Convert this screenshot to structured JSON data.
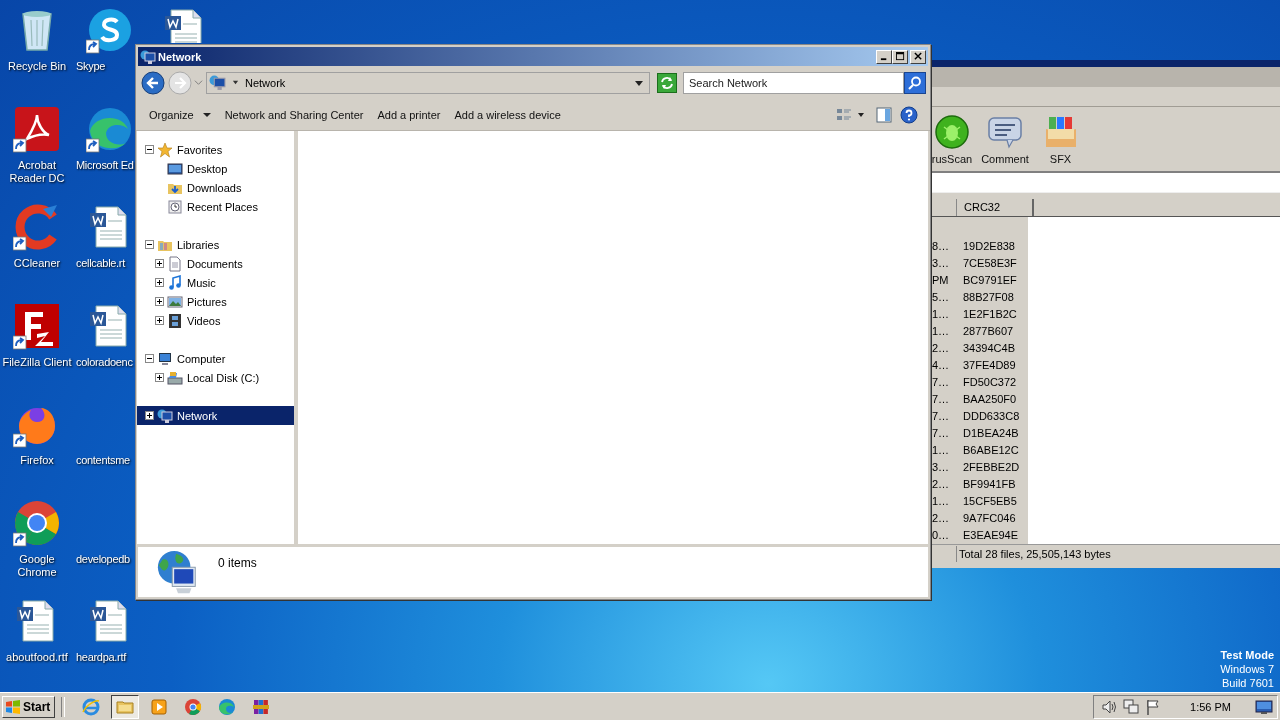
{
  "desktop": {
    "columns": [
      [
        {
          "label": "Recycle Bin",
          "kind": "recycle",
          "shortcut": false
        },
        {
          "label": "Acrobat Reader DC",
          "kind": "acrobat",
          "shortcut": true
        },
        {
          "label": "CCleaner",
          "kind": "ccleaner",
          "shortcut": true
        },
        {
          "label": "FileZilla Client",
          "kind": "filezilla",
          "shortcut": true
        },
        {
          "label": "Firefox",
          "kind": "firefox",
          "shortcut": true
        },
        {
          "label": "Google Chrome",
          "kind": "chrome",
          "shortcut": true
        },
        {
          "label": "aboutfood.rtf",
          "kind": "word",
          "shortcut": false
        }
      ],
      [
        {
          "label": "Skype",
          "kind": "skype",
          "shortcut": true
        },
        {
          "label": "Microsoft Ed",
          "kind": "edge",
          "shortcut": true
        },
        {
          "label": "cellcable.rt",
          "kind": "word",
          "shortcut": false
        },
        {
          "label": "coloradoenc",
          "kind": "word",
          "shortcut": false
        },
        {
          "label": "contentsme",
          "kind": "blank"
        },
        {
          "label": "developedb",
          "kind": "blank"
        },
        {
          "label": "heardpa.rtf",
          "kind": "word",
          "shortcut": false
        }
      ],
      [
        {
          "kind": "word",
          "shortcut": false
        }
      ]
    ],
    "os_notice": [
      "Test Mode",
      "Windows 7",
      "Build 7601"
    ]
  },
  "archiver": {
    "toolbar": [
      {
        "label": "rusScan",
        "kind": "virus"
      },
      {
        "label": "Comment",
        "kind": "comment"
      },
      {
        "label": "SFX",
        "kind": "sfx"
      }
    ],
    "columns": [
      "CRC32"
    ],
    "rows": [
      {
        "column_1": "8…",
        "crc32": "19D2E838"
      },
      {
        "column_1": "3…",
        "crc32": "7CE58E3F"
      },
      {
        "column_1": "PM",
        "crc32": "BC9791EF"
      },
      {
        "column_1": "5…",
        "crc32": "88B27F08"
      },
      {
        "column_1": "1…",
        "crc32": "1E2F1B2C"
      },
      {
        "column_1": "1…",
        "crc32": "2877B607"
      },
      {
        "column_1": "2…",
        "crc32": "34394C4B"
      },
      {
        "column_1": "4…",
        "crc32": "37FE4D89"
      },
      {
        "column_1": "7…",
        "crc32": "FD50C372"
      },
      {
        "column_1": "7…",
        "crc32": "BAA250F0"
      },
      {
        "column_1": "7…",
        "crc32": "DDD633C8"
      },
      {
        "column_1": "7…",
        "crc32": "D1BEA24B"
      },
      {
        "column_1": "1…",
        "crc32": "B6ABE12C"
      },
      {
        "column_1": "3…",
        "crc32": "2FEBBE2D"
      },
      {
        "column_1": "2…",
        "crc32": "BF9941FB"
      },
      {
        "column_1": "1…",
        "crc32": "15CF5EB5"
      },
      {
        "column_1": "2…",
        "crc32": "9A7FC046"
      },
      {
        "column_1": "0…",
        "crc32": "E3EAE94E"
      }
    ],
    "status": "Total 28 files, 25,505,143 bytes"
  },
  "explorer": {
    "title": "Network",
    "address": "Network",
    "search": {
      "placeholder": "Search Network"
    },
    "toolbar": [
      {
        "label": "Organize",
        "dropdown": true
      },
      {
        "label": "Network and Sharing Center",
        "dropdown": false
      },
      {
        "label": "Add a printer",
        "dropdown": false
      },
      {
        "label": "Add a wireless device",
        "dropdown": false
      }
    ],
    "tree": [
      {
        "label": "Favorites",
        "kind": "star",
        "expanded": true,
        "selected": false,
        "children": [
          {
            "label": "Desktop",
            "kind": "desktop",
            "selected": false
          },
          {
            "label": "Downloads",
            "kind": "downloads",
            "selected": false
          },
          {
            "label": "Recent Places",
            "kind": "recent",
            "selected": false
          }
        ]
      },
      {
        "label": "Libraries",
        "kind": "libraries",
        "expanded": true,
        "selected": false,
        "children": [
          {
            "label": "Documents",
            "kind": "documents",
            "expanded": false,
            "selected": false
          },
          {
            "label": "Music",
            "kind": "music",
            "expanded": false,
            "selected": false
          },
          {
            "label": "Pictures",
            "kind": "pictures",
            "expanded": false,
            "selected": false
          },
          {
            "label": "Videos",
            "kind": "videos",
            "expanded": false,
            "selected": false
          }
        ]
      },
      {
        "label": "Computer",
        "kind": "computer",
        "expanded": true,
        "selected": false,
        "children": [
          {
            "label": "Local Disk (C:)",
            "kind": "disk",
            "expanded": false,
            "selected": false
          }
        ]
      },
      {
        "label": "Network",
        "kind": "network",
        "expanded": false,
        "selected": true
      }
    ],
    "details": "0 items"
  },
  "taskbar": {
    "start": "Start",
    "apps": [
      {
        "kind": "ie",
        "selected": false
      },
      {
        "kind": "explorer",
        "selected": true
      },
      {
        "kind": "media",
        "selected": false
      },
      {
        "kind": "chrome",
        "selected": false
      },
      {
        "kind": "edge",
        "selected": false
      },
      {
        "kind": "winrar",
        "selected": false
      }
    ],
    "clock": "1:56 PM"
  }
}
